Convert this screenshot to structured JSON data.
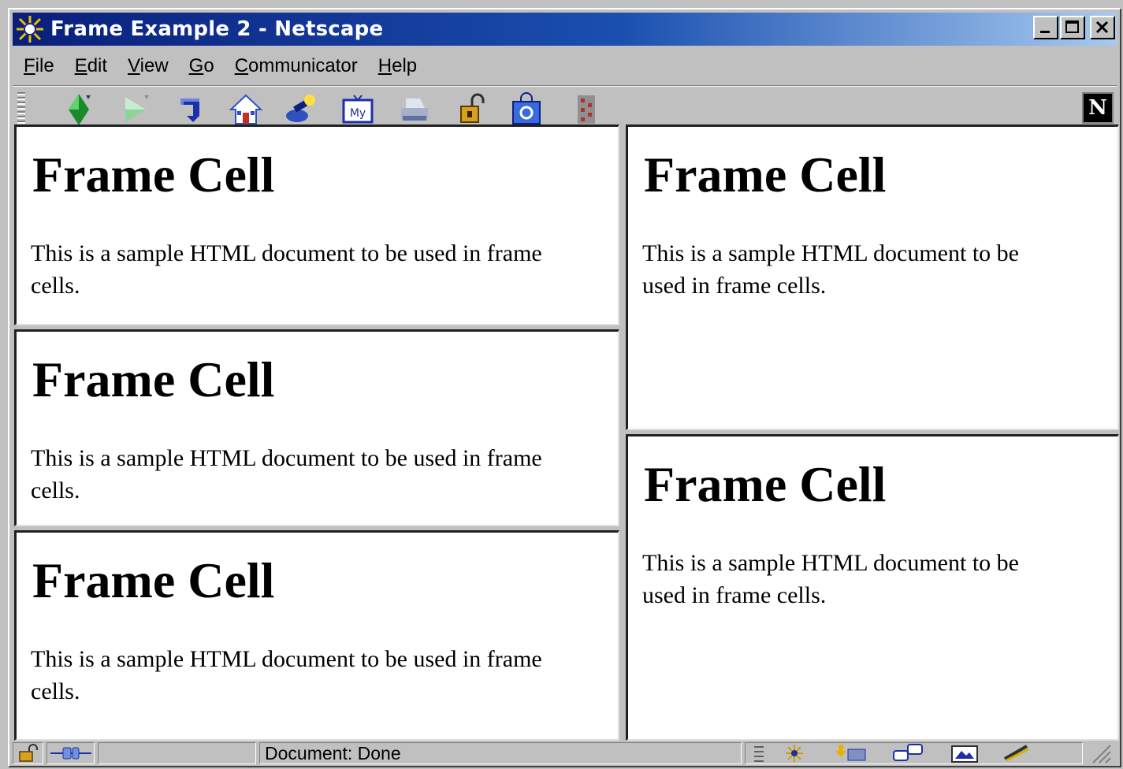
{
  "window": {
    "title": "Frame Example 2 - Netscape",
    "minimize_label": "minimize",
    "maximize_label": "maximize",
    "close_label": "close"
  },
  "menu": {
    "items": [
      {
        "label": "File",
        "key": "F",
        "rest": "ile"
      },
      {
        "label": "Edit",
        "key": "E",
        "rest": "dit"
      },
      {
        "label": "View",
        "key": "V",
        "rest": "iew"
      },
      {
        "label": "Go",
        "key": "G",
        "rest": "o"
      },
      {
        "label": "Communicator",
        "key": "C",
        "rest": "ommunicator"
      },
      {
        "label": "Help",
        "key": "H",
        "rest": "elp"
      }
    ]
  },
  "toolbar": {
    "buttons": [
      {
        "icon": "back-icon"
      },
      {
        "icon": "forward-icon"
      },
      {
        "icon": "reload-icon"
      },
      {
        "icon": "home-icon"
      },
      {
        "icon": "search-icon"
      },
      {
        "icon": "my-netscape-icon",
        "text": "My"
      },
      {
        "icon": "print-icon"
      },
      {
        "icon": "security-icon"
      },
      {
        "icon": "shop-icon"
      },
      {
        "icon": "stop-icon"
      }
    ],
    "logo": "N"
  },
  "frames": [
    {
      "heading": "Frame Cell",
      "body": "This is a sample HTML document to be used in frame cells."
    },
    {
      "heading": "Frame Cell",
      "body": "This is a sample HTML document to be used in frame cells."
    },
    {
      "heading": "Frame Cell",
      "body": "This is a sample HTML document to be used in frame cells."
    },
    {
      "heading": "Frame Cell",
      "body": "This is a sample HTML document to be used in frame cells."
    },
    {
      "heading": "Frame Cell",
      "body": "This is a sample HTML document to be used in frame cells."
    }
  ],
  "status": {
    "text": "Document: Done",
    "colors": {
      "titlebar_start": "#0a1e7a",
      "titlebar_end": "#a6caf0",
      "chrome": "#c0c0c0"
    }
  }
}
